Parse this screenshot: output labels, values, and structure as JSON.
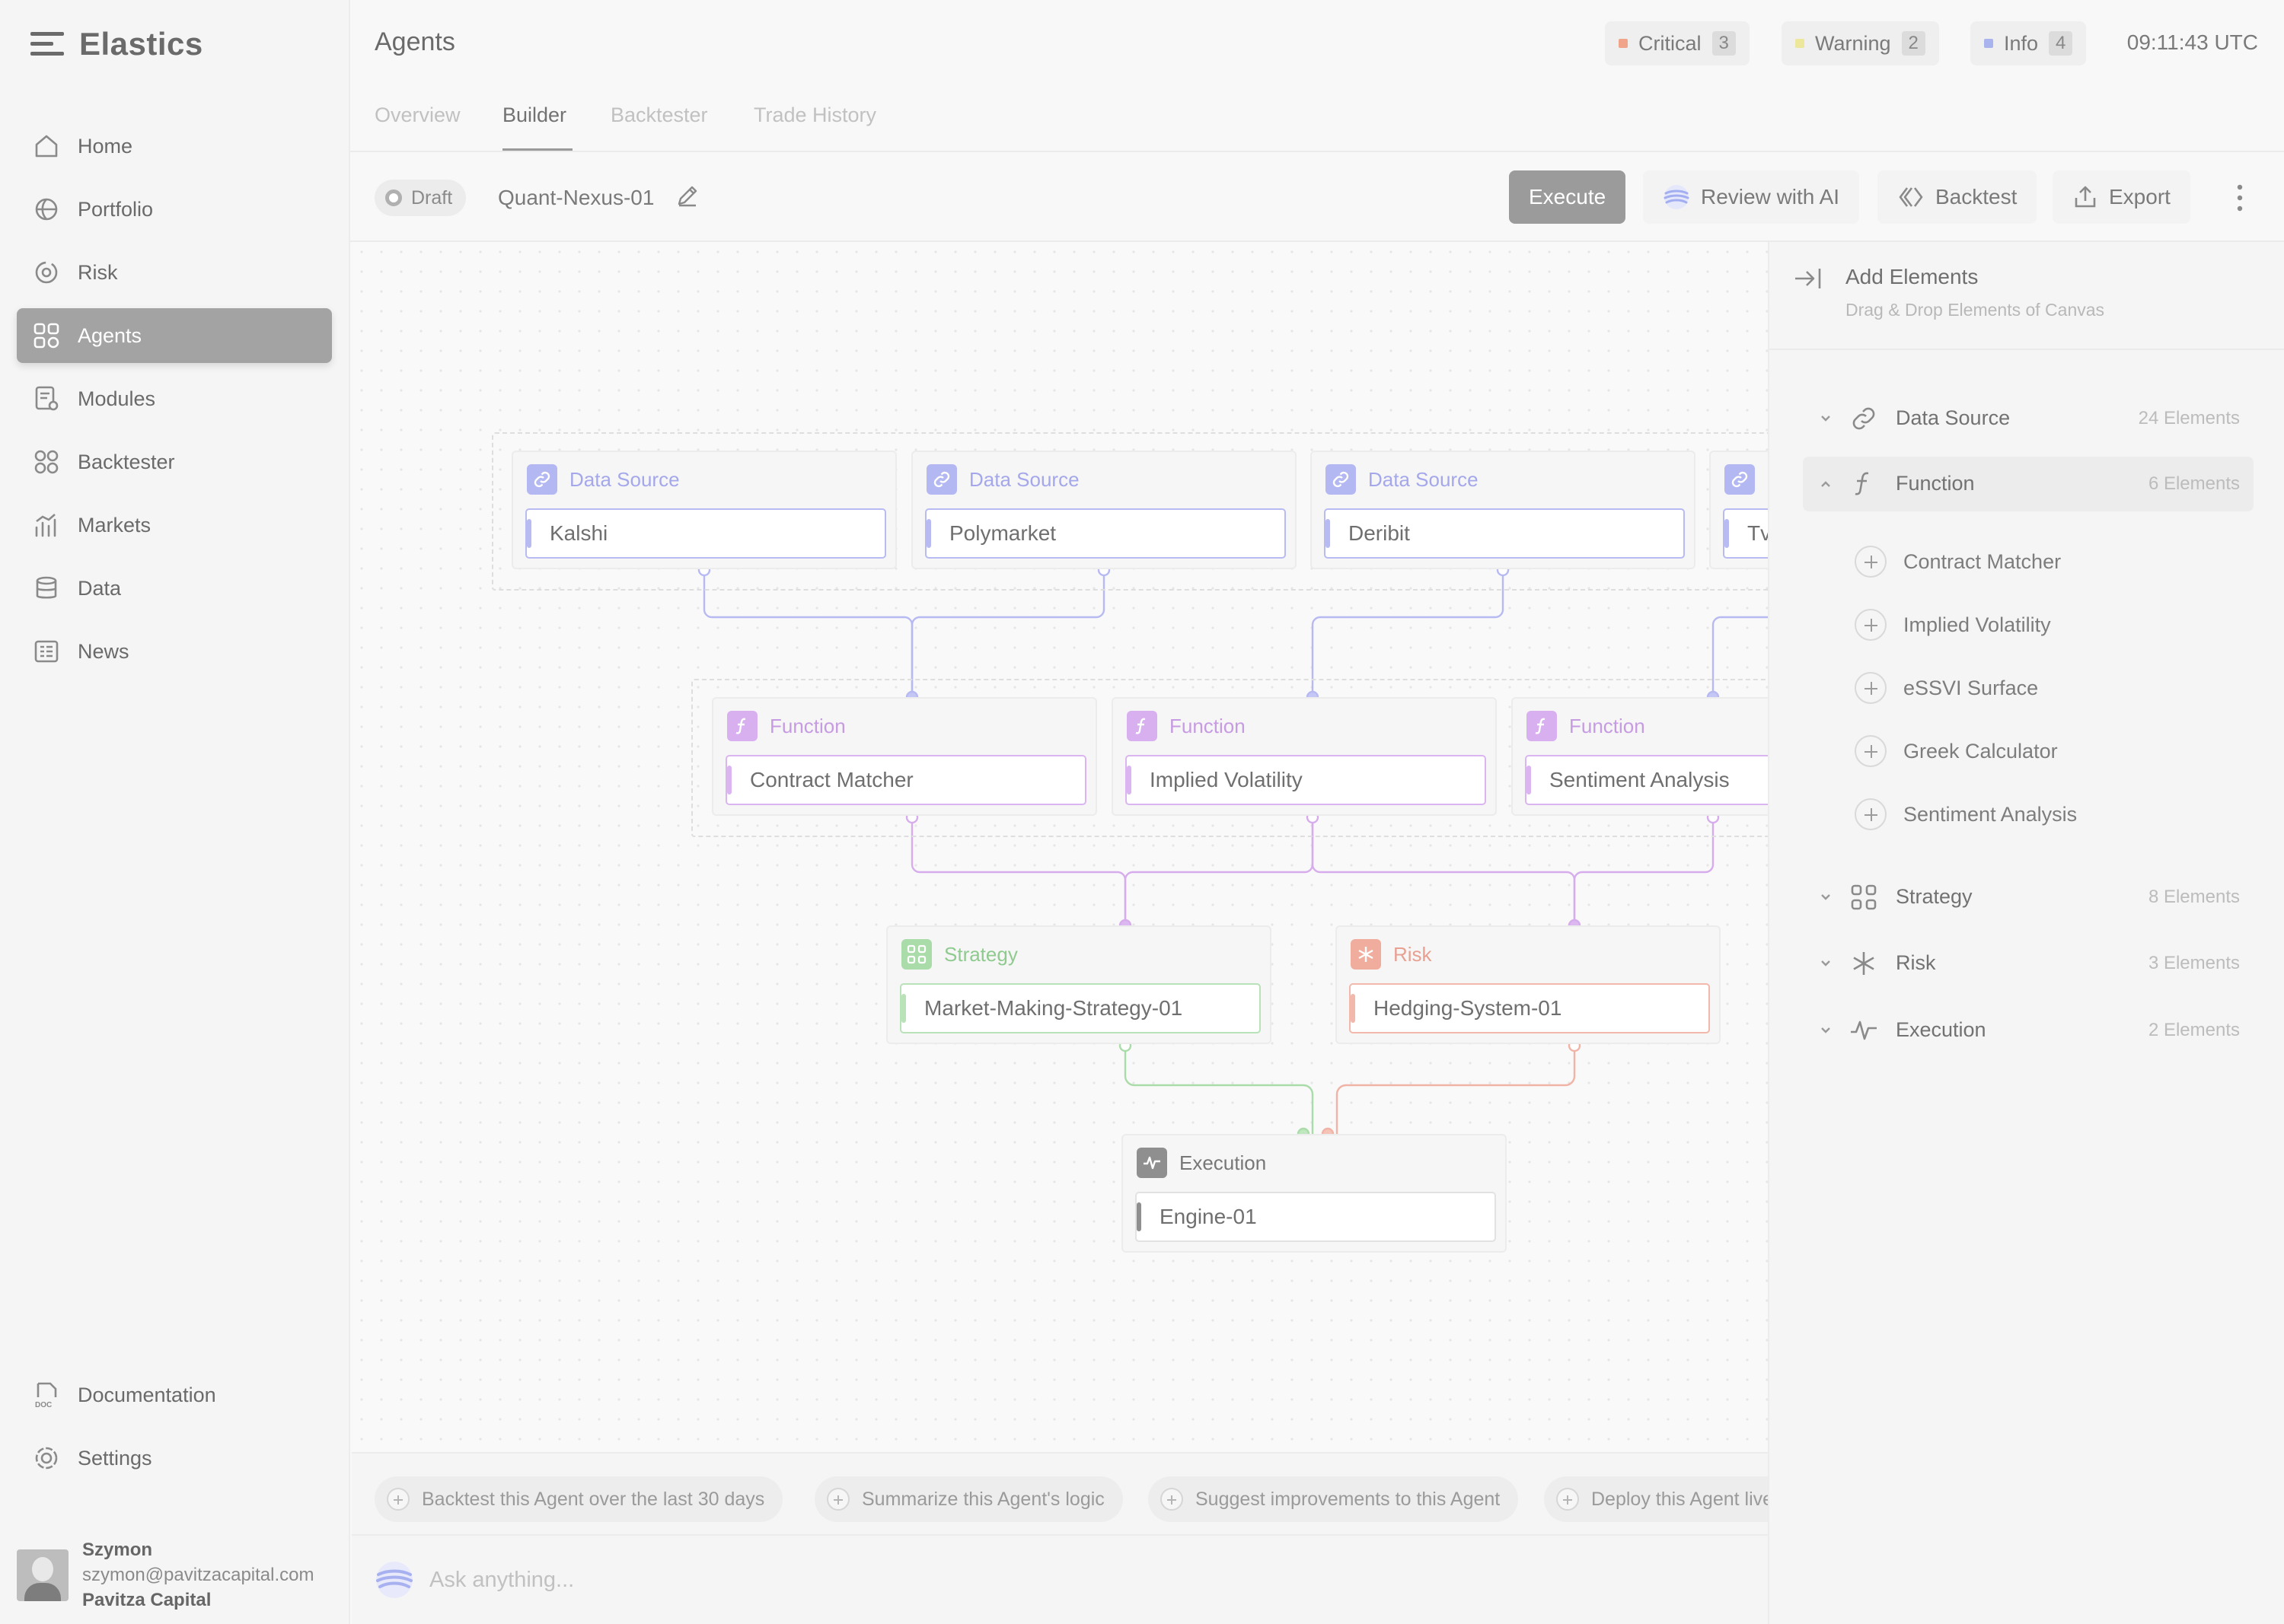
{
  "app": {
    "name": "Elastics"
  },
  "sidebar": {
    "items": [
      {
        "label": "Home",
        "icon": "home-icon"
      },
      {
        "label": "Portfolio",
        "icon": "globe-icon"
      },
      {
        "label": "Risk",
        "icon": "risk-icon"
      },
      {
        "label": "Agents",
        "icon": "agents-icon",
        "active": true
      },
      {
        "label": "Modules",
        "icon": "modules-icon"
      },
      {
        "label": "Backtester",
        "icon": "backtester-icon"
      },
      {
        "label": "Markets",
        "icon": "markets-icon"
      },
      {
        "label": "Data",
        "icon": "data-icon"
      },
      {
        "label": "News",
        "icon": "news-icon"
      }
    ],
    "bottom_items": [
      {
        "label": "Documentation",
        "icon": "doc-icon"
      },
      {
        "label": "Settings",
        "icon": "settings-icon"
      }
    ],
    "user": {
      "name": "Szymon",
      "email": "szymon@pavitzacapital.com",
      "org": "Pavitza Capital"
    }
  },
  "header": {
    "title": "Agents",
    "alerts": [
      {
        "label": "Critical",
        "count": "3",
        "color": "#f0a58a"
      },
      {
        "label": "Warning",
        "count": "2",
        "color": "#ece79a"
      },
      {
        "label": "Info",
        "count": "4",
        "color": "#a9b4ee"
      }
    ],
    "clock": "09:11:43 UTC"
  },
  "tabs": [
    {
      "label": "Overview"
    },
    {
      "label": "Builder",
      "active": true
    },
    {
      "label": "Backtester"
    },
    {
      "label": "Trade History"
    }
  ],
  "toolbar": {
    "status": "Draft",
    "agent_name": "Quant-Nexus-01",
    "execute": "Execute",
    "review": "Review with AI",
    "backtest": "Backtest",
    "export": "Export"
  },
  "canvas": {
    "nodes": [
      {
        "type": "Data Source",
        "value": "Kalshi"
      },
      {
        "type": "Data Source",
        "value": "Polymarket"
      },
      {
        "type": "Data Source",
        "value": "Deribit"
      },
      {
        "type": "Data Source",
        "value": "Tv"
      },
      {
        "type": "Function",
        "value": "Contract Matcher"
      },
      {
        "type": "Function",
        "value": "Implied Volatility"
      },
      {
        "type": "Function",
        "value": "Sentiment Analysis"
      },
      {
        "type": "Strategy",
        "value": "Market-Making-Strategy-01"
      },
      {
        "type": "Risk",
        "value": "Hedging-System-01"
      },
      {
        "type": "Execution",
        "value": "Engine-01"
      }
    ],
    "colors": {
      "data_source": "#a9adf0",
      "function": "#cfa1e6",
      "strategy": "#9fd49f",
      "risk": "#eea595",
      "execution": "#8f8f8f"
    }
  },
  "panel": {
    "title": "Add Elements",
    "subtitle": "Drag & Drop Elements of Canvas",
    "categories": [
      {
        "label": "Data Source",
        "count": "24 Elements",
        "icon": "link-icon"
      },
      {
        "label": "Function",
        "count": "6 Elements",
        "icon": "function-icon",
        "open": true
      },
      {
        "label": "Strategy",
        "count": "8 Elements",
        "icon": "strategy-icon"
      },
      {
        "label": "Risk",
        "count": "3 Elements",
        "icon": "asterisk-icon"
      },
      {
        "label": "Execution",
        "count": "2 Elements",
        "icon": "execution-icon"
      }
    ],
    "function_items": [
      "Contract Matcher",
      "Implied Volatility",
      "eSSVI Surface",
      "Greek Calculator",
      "Sentiment Analysis"
    ]
  },
  "suggestions": [
    "Backtest this Agent over the last 30 days",
    "Summarize this Agent's logic",
    "Suggest improvements to this Agent",
    "Deploy this Agent live"
  ],
  "ask": {
    "placeholder": "Ask anything..."
  }
}
